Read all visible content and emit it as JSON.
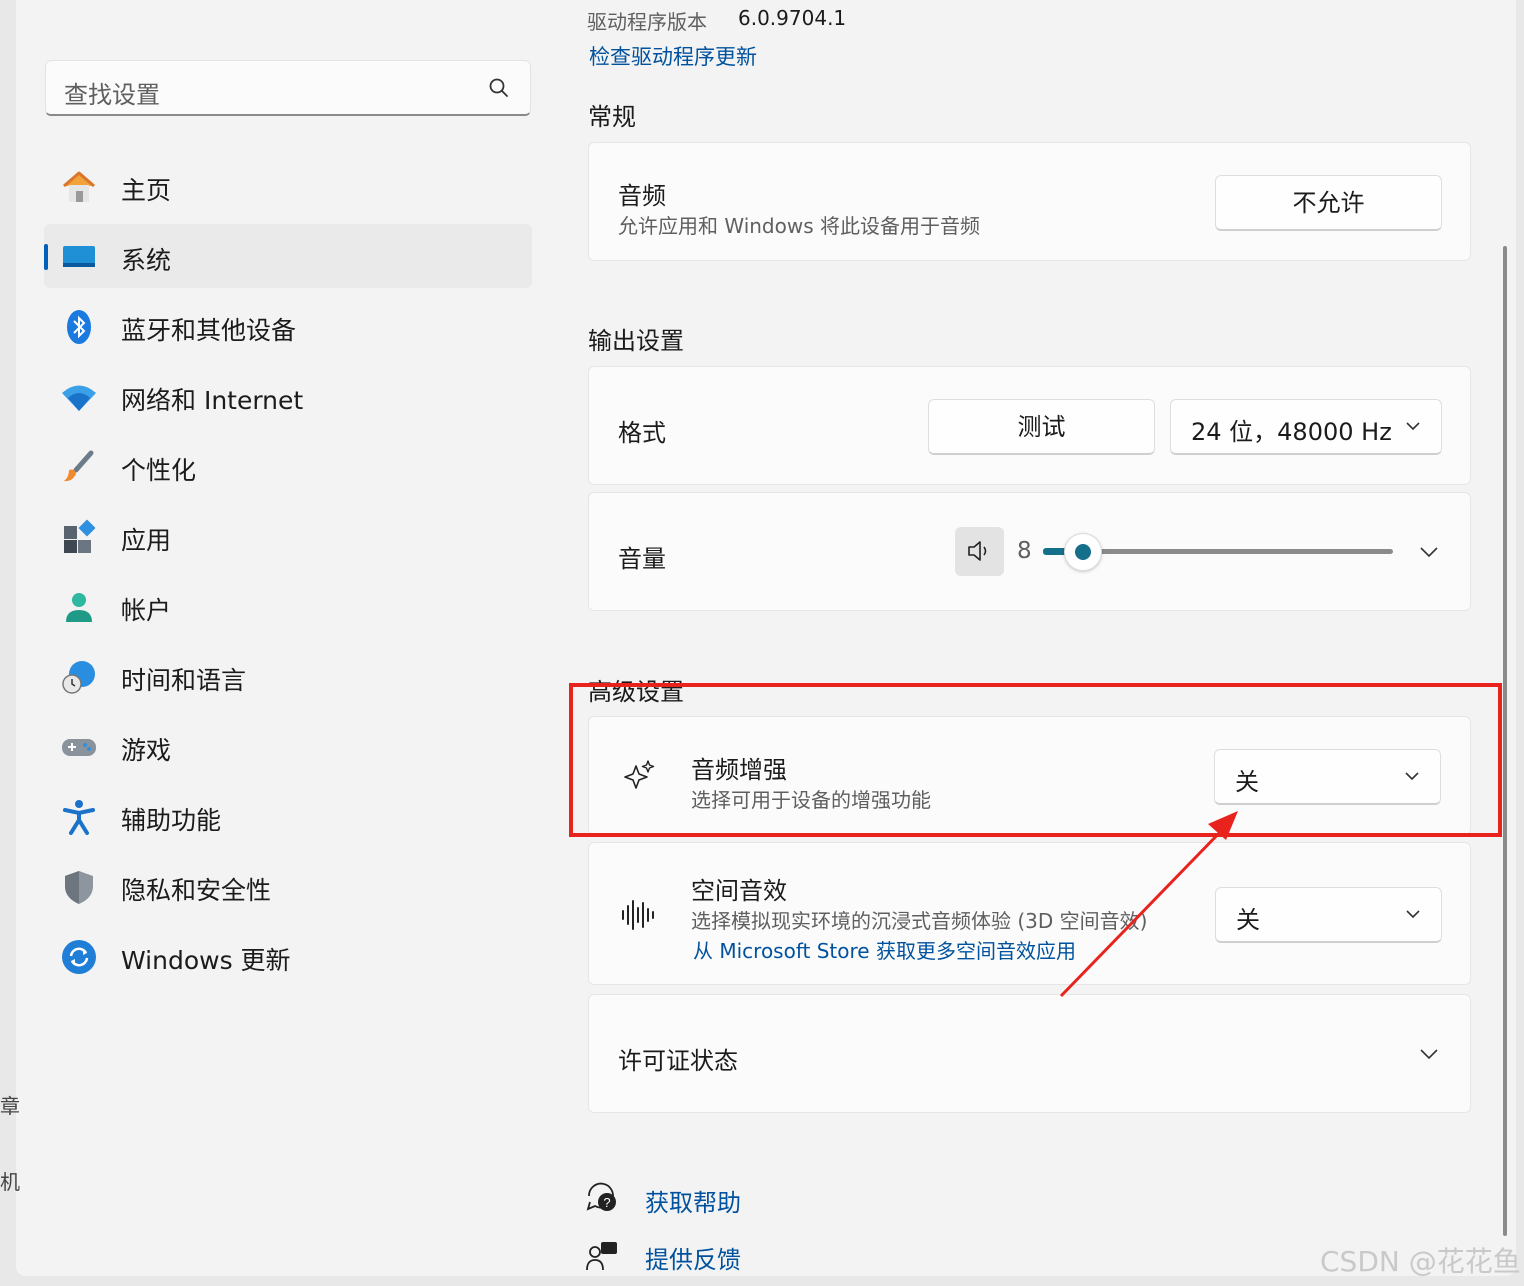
{
  "search": {
    "placeholder": "查找设置"
  },
  "nav": {
    "items": [
      {
        "label": "主页",
        "icon": "home-icon"
      },
      {
        "label": "系统",
        "icon": "system-icon"
      },
      {
        "label": "蓝牙和其他设备",
        "icon": "bluetooth-icon"
      },
      {
        "label": "网络和 Internet",
        "icon": "wifi-icon"
      },
      {
        "label": "个性化",
        "icon": "brush-icon"
      },
      {
        "label": "应用",
        "icon": "apps-icon"
      },
      {
        "label": "帐户",
        "icon": "account-icon"
      },
      {
        "label": "时间和语言",
        "icon": "globe-clock-icon"
      },
      {
        "label": "游戏",
        "icon": "gamepad-icon"
      },
      {
        "label": "辅助功能",
        "icon": "accessibility-icon"
      },
      {
        "label": "隐私和安全性",
        "icon": "shield-icon"
      },
      {
        "label": "Windows 更新",
        "icon": "update-icon"
      }
    ],
    "active_index": 1
  },
  "driver": {
    "version_label": "驱动程序版本",
    "version_value": "6.0.9704.1",
    "check_link": "检查驱动程序更新"
  },
  "general": {
    "title": "常规",
    "audio": {
      "title": "音频",
      "desc": "允许应用和 Windows 将此设备用于音频",
      "button": "不允许"
    }
  },
  "output": {
    "title": "输出设置",
    "format": {
      "label": "格式",
      "test_button": "测试",
      "format_value": "24 位，48000 Hz"
    },
    "volume": {
      "label": "音量",
      "value": "8",
      "level": 0.08
    }
  },
  "advanced": {
    "title": "高级设置",
    "enhance": {
      "title": "音频增强",
      "desc": "选择可用于设备的增强功能",
      "value": "关"
    },
    "spatial": {
      "title": "空间音效",
      "desc": "选择模拟现实环境的沉浸式音频体验 (3D 空间音效)",
      "link": "从 Microsoft Store 获取更多空间音效应用",
      "value": "关"
    },
    "license": {
      "title": "许可证状态"
    }
  },
  "help": {
    "get_help": "获取帮助",
    "feedback": "提供反馈"
  },
  "watermark": "CSDN @花花鱼",
  "edge": {
    "left1": "章",
    "left2": "机"
  },
  "colors": {
    "accent": "#005fb8",
    "annotation": "#e8231d",
    "link": "#00529e"
  }
}
